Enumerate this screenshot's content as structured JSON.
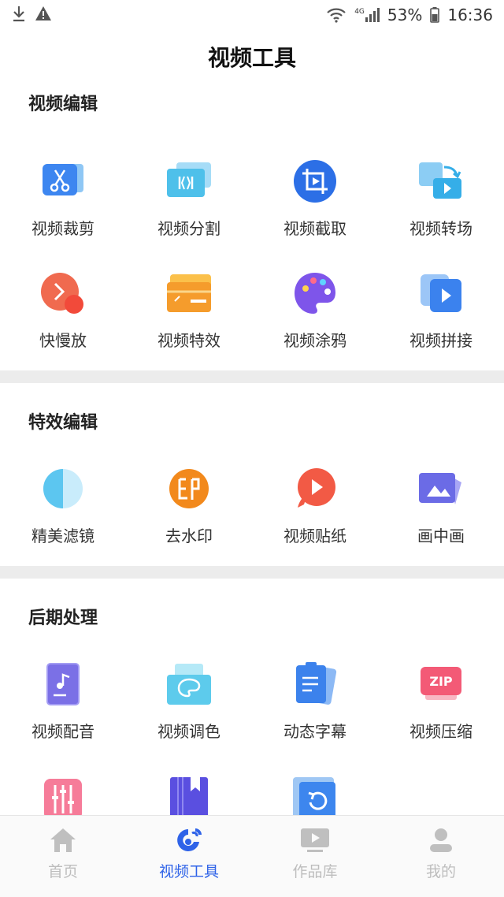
{
  "status": {
    "battery": "53%",
    "time": "16:36",
    "network": "4G"
  },
  "title": "视频工具",
  "sections": [
    {
      "title": "视频编辑",
      "tools": [
        {
          "label": "视频裁剪",
          "icon": "scissors-icon"
        },
        {
          "label": "视频分割",
          "icon": "split-icon"
        },
        {
          "label": "视频截取",
          "icon": "crop-icon"
        },
        {
          "label": "视频转场",
          "icon": "transition-icon"
        },
        {
          "label": "快慢放",
          "icon": "speed-icon"
        },
        {
          "label": "视频特效",
          "icon": "effects-icon"
        },
        {
          "label": "视频涂鸦",
          "icon": "palette-icon"
        },
        {
          "label": "视频拼接",
          "icon": "merge-icon"
        }
      ]
    },
    {
      "title": "特效编辑",
      "tools": [
        {
          "label": "精美滤镜",
          "icon": "filter-icon"
        },
        {
          "label": "去水印",
          "icon": "watermark-icon"
        },
        {
          "label": "视频贴纸",
          "icon": "sticker-icon"
        },
        {
          "label": "画中画",
          "icon": "picture-in-picture-icon"
        }
      ]
    },
    {
      "title": "后期处理",
      "tools": [
        {
          "label": "视频配音",
          "icon": "music-icon"
        },
        {
          "label": "视频调色",
          "icon": "color-icon"
        },
        {
          "label": "动态字幕",
          "icon": "subtitle-icon"
        },
        {
          "label": "视频压缩",
          "icon": "zip-icon"
        },
        {
          "label": "",
          "icon": "equalizer-icon"
        },
        {
          "label": "",
          "icon": "bookmark-icon"
        },
        {
          "label": "",
          "icon": "rotate-icon"
        }
      ]
    }
  ],
  "tabs": [
    {
      "label": "首页",
      "icon": "home-icon",
      "active": false
    },
    {
      "label": "视频工具",
      "icon": "tools-icon",
      "active": true
    },
    {
      "label": "作品库",
      "icon": "library-icon",
      "active": false
    },
    {
      "label": "我的",
      "icon": "profile-icon",
      "active": false
    }
  ],
  "colors": {
    "accent": "#2f63e8",
    "tab_inactive": "#bdbdbd",
    "divider": "#ececec"
  }
}
